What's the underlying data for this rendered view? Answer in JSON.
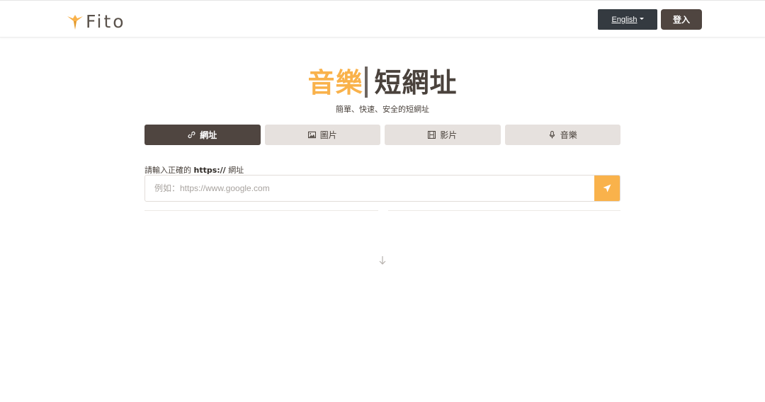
{
  "navbar": {
    "brand_name": "Fito",
    "brand_icon": "bird-logo-icon",
    "language_label": "English",
    "login_label": "登入"
  },
  "hero": {
    "title_accent": "音樂",
    "title_main": "短網址",
    "subtitle": "簡單、快速、安全的短網址"
  },
  "tabs": [
    {
      "label": "網址",
      "icon": "link-icon",
      "active": true
    },
    {
      "label": "圖片",
      "icon": "image-icon",
      "active": false
    },
    {
      "label": "影片",
      "icon": "film-icon",
      "active": false
    },
    {
      "label": "音樂",
      "icon": "microphone-icon",
      "active": false
    }
  ],
  "form": {
    "label_prefix": "請輸入正確的",
    "label_bold": "https://",
    "label_suffix": "網址",
    "input_placeholder": "例如：https://www.google.com",
    "input_value": "",
    "submit_icon": "send-icon"
  },
  "scroll_hint_icon": "arrow-down-icon",
  "colors": {
    "accent": "#f9b24b",
    "primary_dark": "#4f4540",
    "tab_bg": "#e6e1de",
    "lang_btn_bg": "#343a40"
  }
}
